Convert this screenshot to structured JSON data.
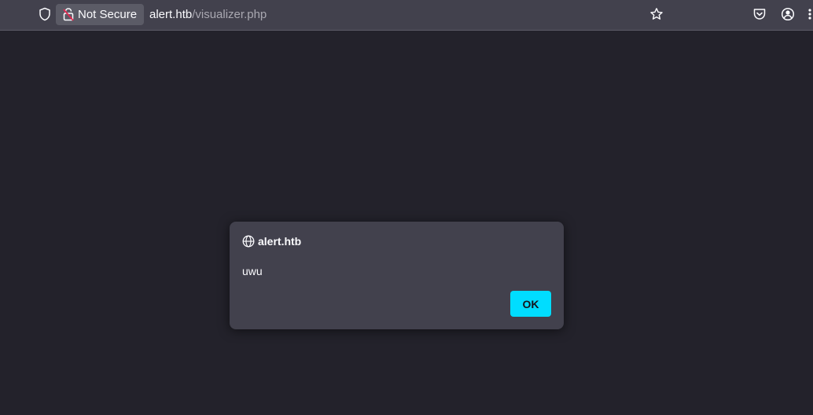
{
  "toolbar": {
    "security_label": "Not Secure",
    "url_host": "alert.htb",
    "url_path": "/visualizer.php",
    "icons": [
      "shield-icon",
      "insecure-lock-icon",
      "star-icon",
      "pocket-icon",
      "account-icon",
      "overflow-icon"
    ]
  },
  "dialog": {
    "origin": "alert.htb",
    "message": "uwu",
    "ok_label": "OK",
    "icon": "globe-icon"
  },
  "colors": {
    "page_background": "#23222b",
    "toolbar_background": "#42414d",
    "dialog_background": "#42414d",
    "accent": "#00ddff",
    "insecure_lock": "#e22850"
  }
}
